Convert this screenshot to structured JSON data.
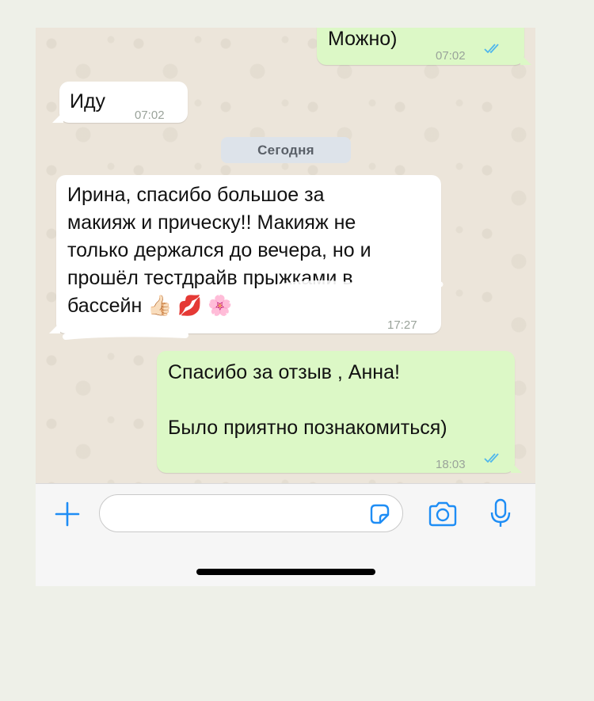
{
  "messages": [
    {
      "direction": "out",
      "text": "Можно)",
      "time": "07:02",
      "status": "read"
    },
    {
      "direction": "in",
      "text": "Иду",
      "time": "07:02"
    },
    {
      "direction": "in",
      "lines": [
        "Ирина, спасибо большое за",
        "макияж и прическу!! Макияж не",
        "только держался до вечера, но и",
        "прошёл тестдрайв прыжками в",
        "бассейн 👍🏻 💋 🌸"
      ],
      "time": "17:27"
    },
    {
      "direction": "out",
      "lines": [
        "Спасибо за отзыв , Анна!",
        "",
        "Было приятно познакомиться)"
      ],
      "time": "18:03",
      "status": "read"
    }
  ],
  "date_divider": "Сегодня",
  "composer": {
    "placeholder": "",
    "icons": [
      "plus-icon",
      "sticker-icon",
      "camera-icon",
      "microphone-icon"
    ]
  },
  "colors": {
    "incoming": "#ffffff",
    "outgoing": "#dcf8c6",
    "accent": "#1e8df5",
    "read_ticks": "#4fb6ec"
  }
}
